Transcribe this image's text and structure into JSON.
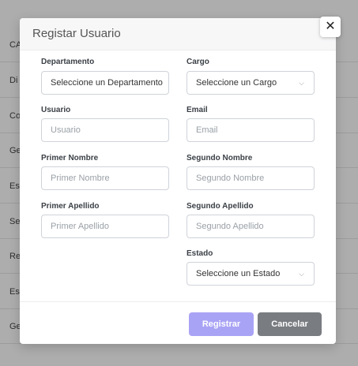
{
  "background": {
    "rows": [
      "CA",
      "Di",
      "Co",
      "Ge",
      "Es",
      "Se",
      "Re",
      "Es",
      "Ge"
    ]
  },
  "modal": {
    "title": "Registar Usuario",
    "close_label": "✕",
    "fields": {
      "departamento": {
        "label": "Departamento",
        "value": "Seleccione un Departamento"
      },
      "cargo": {
        "label": "Cargo",
        "value": "Seleccione un Cargo"
      },
      "usuario": {
        "label": "Usuario",
        "placeholder": "Usuario"
      },
      "email": {
        "label": "Email",
        "placeholder": "Email"
      },
      "primer_nombre": {
        "label": "Primer Nombre",
        "placeholder": "Primer Nombre"
      },
      "segundo_nombre": {
        "label": "Segundo Nombre",
        "placeholder": "Segundo Nombre"
      },
      "primer_apellido": {
        "label": "Primer Apellido",
        "placeholder": "Primer Apellido"
      },
      "segundo_apellido": {
        "label": "Segundo Apellido",
        "placeholder": "Segundo Apellido"
      },
      "estado": {
        "label": "Estado",
        "value": "Seleccione un Estado"
      }
    },
    "chevron": "⌵",
    "buttons": {
      "register": "Registrar",
      "cancel": "Cancelar"
    },
    "colors": {
      "register": "#a9a3f5",
      "cancel": "#797c80"
    }
  }
}
